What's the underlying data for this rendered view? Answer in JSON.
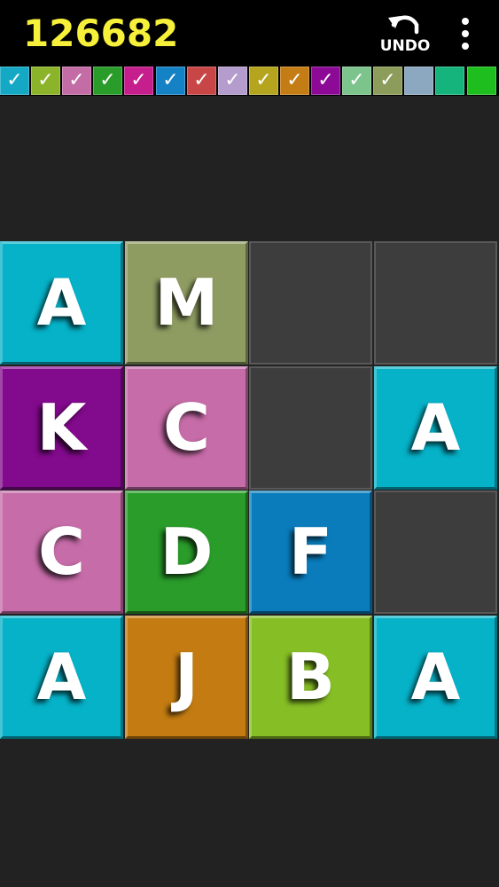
{
  "header": {
    "score": "126682",
    "undo_label": "UNDO"
  },
  "palette": {
    "swatches": [
      {
        "color": "#14a8c4",
        "checked": true
      },
      {
        "color": "#8cb42a",
        "checked": true
      },
      {
        "color": "#c46ca6",
        "checked": true
      },
      {
        "color": "#2a9c2a",
        "checked": true
      },
      {
        "color": "#c61e8c",
        "checked": true
      },
      {
        "color": "#1482c4",
        "checked": true
      },
      {
        "color": "#c84646",
        "checked": true
      },
      {
        "color": "#b49ccc",
        "checked": true
      },
      {
        "color": "#b4a41e",
        "checked": true
      },
      {
        "color": "#c47c14",
        "checked": true
      },
      {
        "color": "#8c0a96",
        "checked": true
      },
      {
        "color": "#7cc48c",
        "checked": true
      },
      {
        "color": "#8c9c5a",
        "checked": true
      },
      {
        "color": "#8ca8c0",
        "checked": false
      },
      {
        "color": "#14b47c",
        "checked": false
      },
      {
        "color": "#1ebe1e",
        "checked": false
      }
    ],
    "check_glyph": "✓"
  },
  "board": {
    "rows": 4,
    "cols": 4,
    "tiles": [
      [
        {
          "letter": "A",
          "color": "#06b2c8"
        },
        {
          "letter": "M",
          "color": "#8e9c62"
        },
        null,
        null
      ],
      [
        {
          "letter": "K",
          "color": "#820a8c"
        },
        {
          "letter": "C",
          "color": "#c66ca8"
        },
        null,
        {
          "letter": "A",
          "color": "#06b2c8"
        }
      ],
      [
        {
          "letter": "C",
          "color": "#c66ca8"
        },
        {
          "letter": "D",
          "color": "#2a9c2a"
        },
        {
          "letter": "F",
          "color": "#0a7cbc"
        },
        null
      ],
      [
        {
          "letter": "A",
          "color": "#06b2c8"
        },
        {
          "letter": "J",
          "color": "#c47c12"
        },
        {
          "letter": "B",
          "color": "#86be26"
        },
        {
          "letter": "A",
          "color": "#06b2c8"
        }
      ]
    ]
  }
}
